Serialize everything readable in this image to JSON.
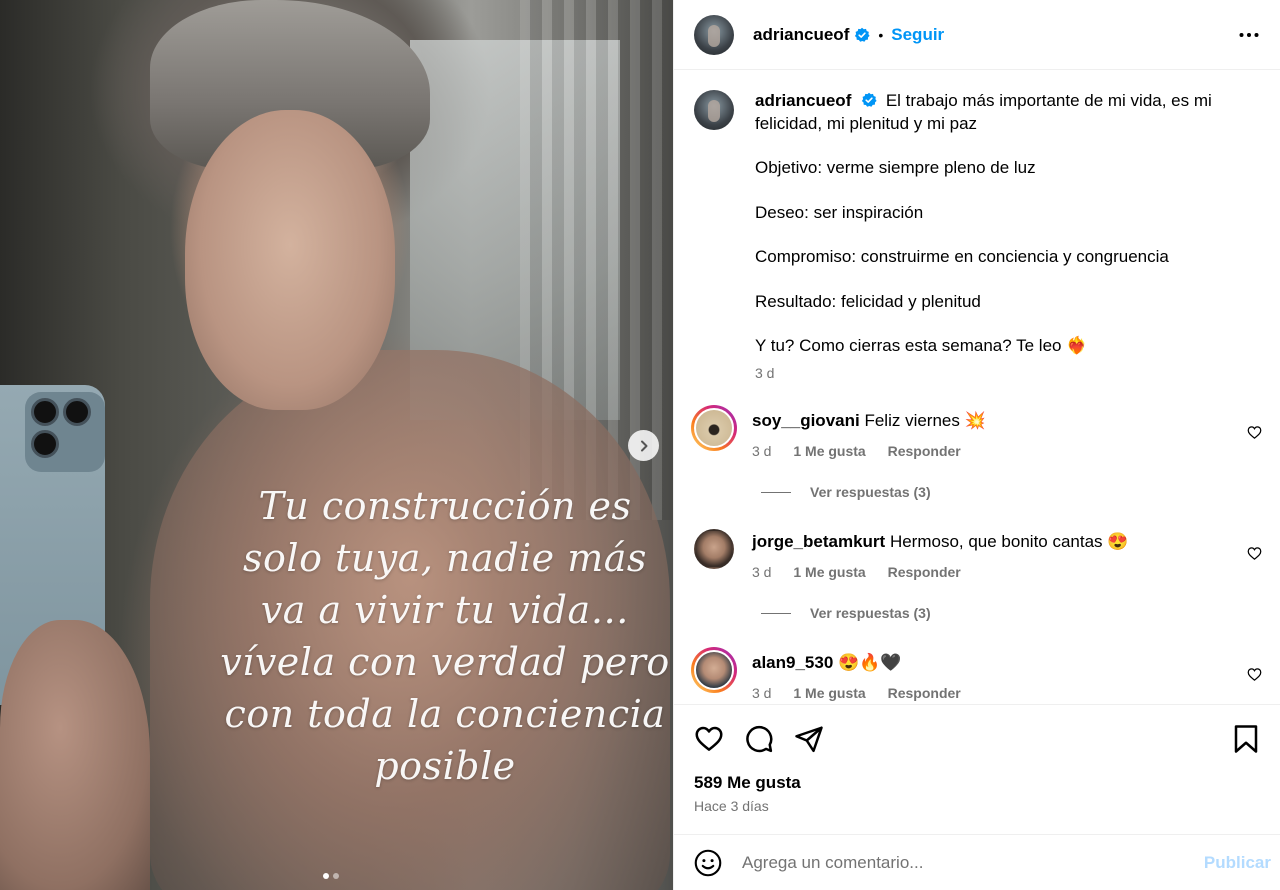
{
  "post": {
    "username": "adriancueof",
    "follow_label": "Seguir",
    "separator": "•",
    "media": {
      "quote": "Tu construcción es solo tuya, nadie más va a vivir tu vida… vívela con verdad pero con toda la conciencia posible",
      "slide_count": 2,
      "active_slide": 1
    }
  },
  "caption": {
    "username": "adriancueof",
    "line1": "El trabajo más importante de mi vida, es mi felicidad, mi plenitud y mi paz",
    "objective": "Objetivo: verme siempre pleno de luz",
    "desire": "Deseo: ser inspiración",
    "commitment": "Compromiso: construirme en conciencia y congruencia",
    "result": "Resultado: felicidad y plenitud",
    "question": "Y tu? Como cierras esta semana? Te leo ❤️‍🔥",
    "time": "3 d"
  },
  "comments": [
    {
      "username": "soy__giovani",
      "text": "Feliz viernes 💥",
      "time": "3 d",
      "likes": "1 Me gusta",
      "reply": "Responder",
      "replies": "Ver respuestas (3)"
    },
    {
      "username": "jorge_betamkurt",
      "text": "Hermoso, que bonito cantas 😍",
      "time": "3 d",
      "likes": "1 Me gusta",
      "reply": "Responder",
      "replies": "Ver respuestas (3)"
    },
    {
      "username": "alan9_530",
      "text": "😍🔥🖤",
      "time": "3 d",
      "likes": "1 Me gusta",
      "reply": "Responder"
    }
  ],
  "footer": {
    "likes": "589 Me gusta",
    "ago": "Hace 3 días",
    "comment_placeholder": "Agrega un comentario...",
    "publish_label": "Publicar"
  },
  "colors": {
    "accent": "#0095f6",
    "publish_disabled": "#b3dbff",
    "secondary_text": "#737373"
  }
}
